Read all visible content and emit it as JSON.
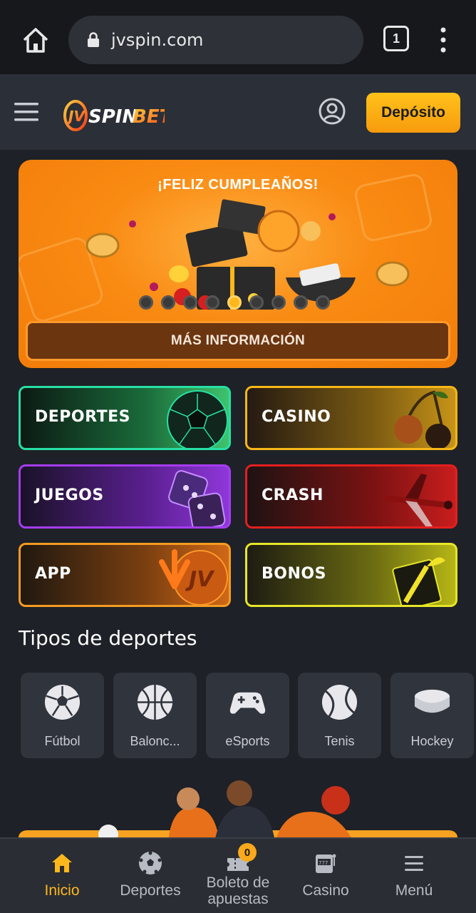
{
  "browser": {
    "url": "jvspin.com",
    "tab_count": "1",
    "icons": {
      "home": "home-icon",
      "lock": "lock-icon",
      "menu": "more-vertical-icon"
    }
  },
  "header": {
    "logo_text": "JVSPINBET",
    "deposit_label": "Depósito",
    "colors": {
      "accent": "#ffb81c",
      "header_bg": "#2b2f37"
    }
  },
  "banner": {
    "title": "¡FELIZ CUMPLEAÑOS!",
    "cta_label": "MÁS INFORMACIÓN",
    "slides_total": 9,
    "active_slide": 5
  },
  "categories": [
    {
      "label": "DEPORTES",
      "color": "#27e0a4"
    },
    {
      "label": "CASINO",
      "color": "#f7b716"
    },
    {
      "label": "JUEGOS",
      "color": "#a53df0"
    },
    {
      "label": "CRASH",
      "color": "#e31f1f"
    },
    {
      "label": "APP",
      "color": "#f59b22"
    },
    {
      "label": "BONOS",
      "color": "#e6e628"
    }
  ],
  "sports": {
    "title": "Tipos de deportes",
    "items": [
      {
        "label": "Fútbol",
        "icon": "soccer-ball-icon"
      },
      {
        "label": "Balonc...",
        "icon": "basketball-icon"
      },
      {
        "label": "eSports",
        "icon": "gamepad-icon"
      },
      {
        "label": "Tenis",
        "icon": "tennis-ball-icon"
      },
      {
        "label": "Hockey",
        "icon": "hockey-puck-icon"
      }
    ]
  },
  "bottom_nav": {
    "items": [
      {
        "label": "Inicio",
        "icon": "home-icon",
        "active": true
      },
      {
        "label": "Deportes",
        "icon": "soccer-ball-icon"
      },
      {
        "label": "Boleto de apuestas",
        "icon": "ticket-icon",
        "badge": "0"
      },
      {
        "label": "Casino",
        "icon": "slot-machine-icon"
      },
      {
        "label": "Menú",
        "icon": "menu-icon"
      }
    ]
  }
}
